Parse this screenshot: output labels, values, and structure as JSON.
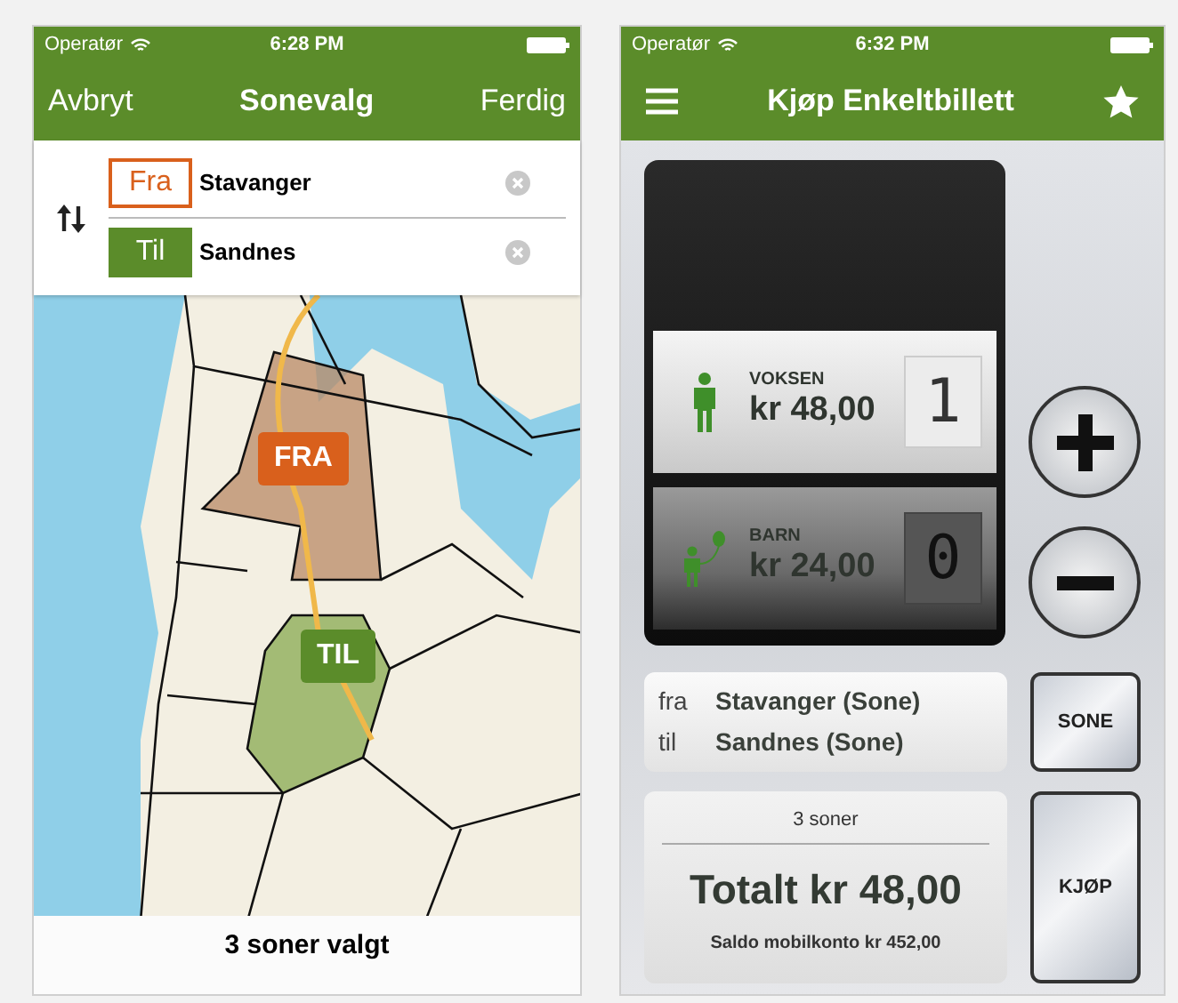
{
  "left_screen": {
    "status_bar": {
      "carrier": "Operatør",
      "time": "6:28 PM"
    },
    "nav_bar": {
      "left": "Avbryt",
      "title": "Sonevalg",
      "right": "Ferdig"
    },
    "route_fields": [
      {
        "label": "Fra",
        "value": "Stavanger",
        "selected": true
      },
      {
        "label": "Til",
        "value": "Sandnes",
        "selected": false
      }
    ],
    "map": {
      "pins": [
        {
          "label": "FRA",
          "color": "#d9601c"
        },
        {
          "label": "TIL",
          "color": "#5b8c2a"
        }
      ]
    },
    "footer": "3 soner valgt"
  },
  "right_screen": {
    "status_bar": {
      "carrier": "Operatør",
      "time": "6:32 PM"
    },
    "nav_bar": {
      "title": "Kjøp Enkeltbillett"
    },
    "passengers": [
      {
        "kind": "adult",
        "label": "VOKSEN",
        "price": "kr 48,00",
        "count": "1",
        "selected": true
      },
      {
        "kind": "child",
        "label": "BARN",
        "price": "kr 24,00",
        "count": "0",
        "selected": false
      }
    ],
    "route": [
      {
        "label": "fra",
        "value": "Stavanger (Sone)"
      },
      {
        "label": "til",
        "value": "Sandnes (Sone)"
      }
    ],
    "zone_button": "SONE",
    "summary": {
      "zones": "3 soner",
      "total": "Totalt kr 48,00",
      "balance": "Saldo mobilkonto kr 452,00"
    },
    "buy_button": "KJØP"
  }
}
